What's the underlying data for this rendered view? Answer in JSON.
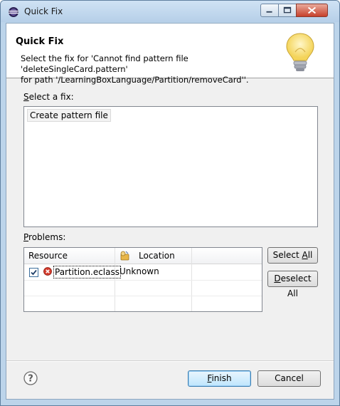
{
  "window": {
    "title": "Quick Fix"
  },
  "banner": {
    "title": "Quick Fix",
    "message_line1": "Select the fix for 'Cannot find pattern file 'deleteSingleCard.pattern'",
    "message_line2": "for path '/LearningBoxLanguage/Partition/removeCard''."
  },
  "fixes": {
    "label_accel": "S",
    "label_rest": "elect a fix:",
    "items": [
      "Create pattern file"
    ]
  },
  "problems": {
    "label_accel": "P",
    "label_rest": "roblems:",
    "columns": [
      "Resource",
      "Location"
    ],
    "rows": [
      {
        "checked": true,
        "resource": "Partition.eclass",
        "location": "Unknown"
      }
    ]
  },
  "buttons": {
    "select_all_pre": "Select ",
    "select_all_accel": "A",
    "select_all_post": "ll",
    "deselect_all_accel": "D",
    "deselect_all_post": "eselect All",
    "finish_accel": "F",
    "finish_post": "inish",
    "cancel": "Cancel"
  },
  "icons": {
    "app": "eclipse-icon",
    "bulb": "lightbulb-icon",
    "error": "error-icon",
    "help": "help-icon",
    "location_header": "location-icon"
  }
}
